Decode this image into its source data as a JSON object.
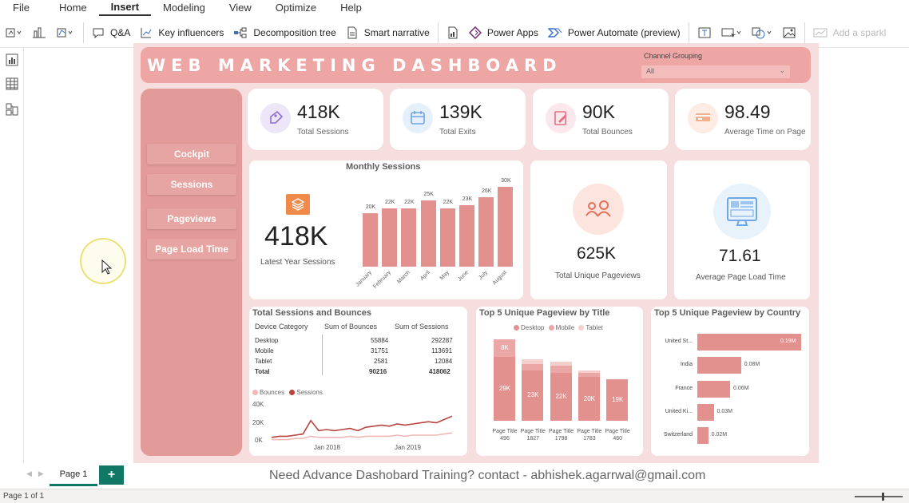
{
  "menu": [
    "File",
    "Home",
    "Insert",
    "Modeling",
    "View",
    "Optimize",
    "Help"
  ],
  "menu_active": "Insert",
  "ribbon": {
    "qa": "Q&A",
    "key_influencers": "Key influencers",
    "decomposition_tree": "Decomposition tree",
    "smart_narrative": "Smart narrative",
    "power_apps": "Power Apps",
    "power_automate": "Power Automate (preview)",
    "add_sparkline": "Add a sparkl"
  },
  "dashboard": {
    "title": "WEB MARKETING DASHBOARD",
    "slicer": {
      "label": "Channel Grouping",
      "value": "All"
    },
    "nav": [
      "Cockpit",
      "Sessions",
      "Pageviews",
      "Page Load Time"
    ],
    "kpis": [
      {
        "value": "418K",
        "label": "Total Sessions",
        "icon": "tag-icon",
        "color": "#ece6f8"
      },
      {
        "value": "139K",
        "label": "Total Exits",
        "icon": "calendar-icon",
        "color": "#e6f0fb"
      },
      {
        "value": "90K",
        "label": "Total Bounces",
        "icon": "edit-icon",
        "color": "#fbe8ec"
      },
      {
        "value": "98.49",
        "label": "Average Time on Page",
        "icon": "card-icon",
        "color": "#fcece4"
      }
    ],
    "monthly": {
      "title": "Monthly Sessions",
      "big_value": "418K",
      "big_label": "Latest Year Sessions"
    },
    "unique_pageviews": {
      "value": "625K",
      "label": "Total Unique Pageviews"
    },
    "page_load": {
      "value": "71.61",
      "label": "Average Page Load Time"
    },
    "sessions_bounces": {
      "title": "Total Sessions and Bounces",
      "headers": [
        "Device Category",
        "Sum of Bounces",
        "Sum of Sessions"
      ],
      "rows": [
        [
          "Desktop",
          "55884",
          "292287"
        ],
        [
          "Mobile",
          "31751",
          "113691"
        ],
        [
          "Tablet",
          "2581",
          "12084"
        ],
        [
          "Total",
          "90216",
          "418062"
        ]
      ],
      "legend": [
        "Bounces",
        "Sessions"
      ],
      "yticks": [
        "40K",
        "20K",
        "0K"
      ],
      "xticks": [
        "Jan 2018",
        "Jan 2019"
      ]
    },
    "top_title": {
      "title": "Top 5 Unique Pageview by Title",
      "legend": [
        "Desktop",
        "Mobile",
        "Tablet"
      ]
    },
    "top_country": {
      "title": "Top 5 Unique Pageview by Country"
    },
    "colors": {
      "accent": "#e3918f",
      "light": "#f6dede",
      "title_bg": "#eda6a4"
    }
  },
  "footer": {
    "page_tab": "Page 1",
    "add_page": "+",
    "message": "Need Advance Dashobard Training? contact - abhishek.agarrwal@gmail.com",
    "status": "Page 1 of 1"
  },
  "chart_data": [
    {
      "type": "bar",
      "title": "Monthly Sessions",
      "categories": [
        "January",
        "February",
        "March",
        "April",
        "May",
        "June",
        "July",
        "August"
      ],
      "values": [
        20,
        22,
        22,
        25,
        22,
        23,
        26,
        30
      ],
      "labels": [
        "20K",
        "22K",
        "22K",
        "25K",
        "22K",
        "23K",
        "26K",
        "30K"
      ],
      "unit": "K",
      "ylim": [
        0,
        30
      ]
    },
    {
      "type": "line",
      "title": "Total Sessions and Bounces",
      "x": [
        "Jan 2018",
        "Jan 2019"
      ],
      "series": [
        {
          "name": "Sessions",
          "color": "#b8433f",
          "values": [
            3,
            4,
            4,
            5,
            6,
            18,
            9,
            10,
            9,
            10,
            11,
            9,
            12,
            13,
            14,
            13,
            15,
            14,
            15,
            16,
            17,
            16,
            19,
            22
          ]
        },
        {
          "name": "Bounces",
          "color": "#f0b8b6",
          "values": [
            1,
            1,
            1,
            2,
            2,
            4,
            3,
            3,
            3,
            3,
            4,
            3,
            4,
            4,
            4,
            4,
            5,
            4,
            5,
            5,
            5,
            5,
            6,
            7
          ]
        }
      ],
      "ylim": [
        0,
        40
      ]
    },
    {
      "type": "bar",
      "title": "Top 5 Unique Pageview by Title",
      "categories": [
        "Page Title 496",
        "Page Title 1827",
        "Page Title 1798",
        "Page Title 1783",
        "Page Title 460"
      ],
      "series": [
        {
          "name": "Desktop",
          "values": [
            29,
            23,
            22,
            20,
            19
          ],
          "labels": [
            "29K",
            "23K",
            "22K",
            "20K",
            "19K"
          ]
        },
        {
          "name": "Mobile",
          "values": [
            8,
            3,
            3,
            2,
            0
          ],
          "labels": [
            "8K",
            "",
            "",
            "",
            ""
          ]
        },
        {
          "name": "Tablet",
          "values": [
            0,
            2,
            2,
            1,
            0
          ],
          "labels": [
            "",
            "",
            "",
            "",
            ""
          ]
        }
      ]
    },
    {
      "type": "bar",
      "title": "Top 5 Unique Pageview by Country",
      "orientation": "horizontal",
      "categories": [
        "United St...",
        "India",
        "France",
        "United Ki...",
        "Switzerland"
      ],
      "values": [
        0.19,
        0.08,
        0.06,
        0.03,
        0.02
      ],
      "labels": [
        "0.19M",
        "0.08M",
        "0.06M",
        "0.03M",
        "0.02M"
      ]
    }
  ]
}
